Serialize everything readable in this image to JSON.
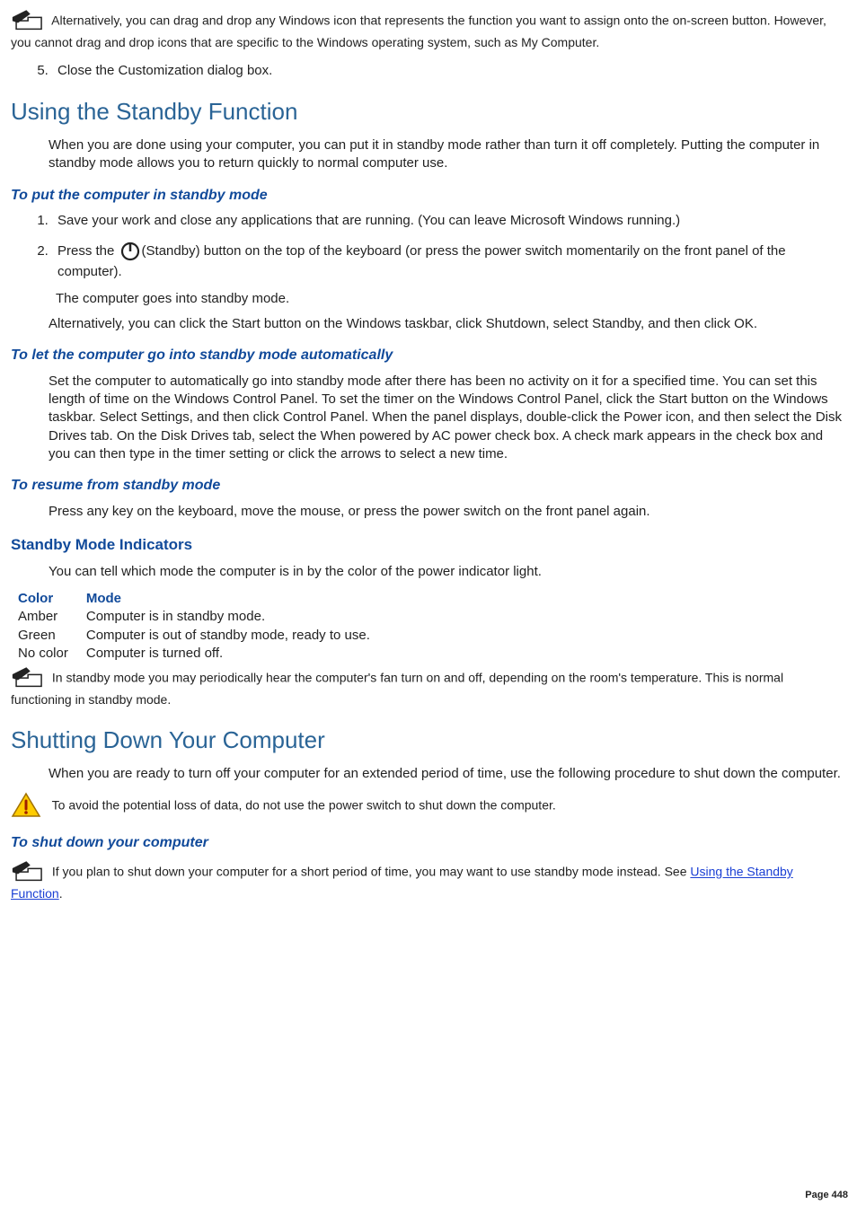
{
  "note1": "Alternatively, you can drag and drop any Windows icon that represents the function you want to assign onto the on-screen button. However, you cannot drag and drop icons that are specific to the Windows operating system, such as My Computer.",
  "ol1_start": "5",
  "ol1_item": "Close the Customization dialog box.",
  "h2_standby": "Using the Standby Function",
  "standby_intro": "When you are done using your computer, you can put it in standby mode rather than turn it off completely. Putting the computer in standby mode allows you to return quickly to normal computer use.",
  "h4_put": "To put the computer in standby mode",
  "ol2_item1": "Save your work and close any applications that are running. (You can leave Microsoft Windows running.)",
  "ol2_item2_a": "Press the ",
  "ol2_item2_b": "(Standby) button on the top of the keyboard (or press the power switch momentarily on the front panel of the computer).",
  "ol2_sub": "The computer goes into standby mode.",
  "ol2_after": "Alternatively, you can click the Start button on the Windows taskbar, click Shutdown, select Standby, and then click OK.",
  "h4_auto": "To let the computer go into standby mode automatically",
  "auto_text": "Set the computer to automatically go into standby mode after there has been no activity on it for a specified time. You can set this length of time on the Windows Control Panel. To set the timer on the Windows Control Panel, click the Start button on the Windows taskbar. Select Settings, and then click Control Panel. When the panel displays, double-click the Power icon, and then select the Disk Drives tab. On the Disk Drives tab, select the When powered by AC power check box. A check mark appears in the check box and you can then type in the timer setting or click the arrows to select a new time.",
  "h4_resume": "To resume from standby mode",
  "resume_text": "Press any key on the keyboard, move the mouse, or press the power switch on the front panel again.",
  "h3_indicators": "Standby Mode Indicators",
  "indicators_intro": "You can tell which mode the computer is in by the color of the power indicator light.",
  "table": {
    "headers": [
      "Color",
      "Mode"
    ],
    "rows": [
      [
        "Amber",
        "Computer is in standby mode."
      ],
      [
        "Green",
        "Computer is out of standby mode, ready to use."
      ],
      [
        "No color",
        "Computer is turned off."
      ]
    ]
  },
  "note2": "In standby mode you may periodically hear the computer's fan turn on and off, depending on the room's temperature. This is normal functioning in standby mode.",
  "h2_shutdown": "Shutting Down Your Computer",
  "shutdown_intro": "When you are ready to turn off your computer for an extended period of time, use the following procedure to shut down the computer.",
  "warn_text": "To avoid the potential loss of data, do not use the power switch to shut down the computer.",
  "h4_shutdown": "To shut down your computer",
  "note3_a": "If you plan to shut down your computer for a short period of time, you may want to use standby mode instead. See ",
  "note3_link": "Using the Standby Function",
  "note3_b": ".",
  "page_num": "Page 448"
}
